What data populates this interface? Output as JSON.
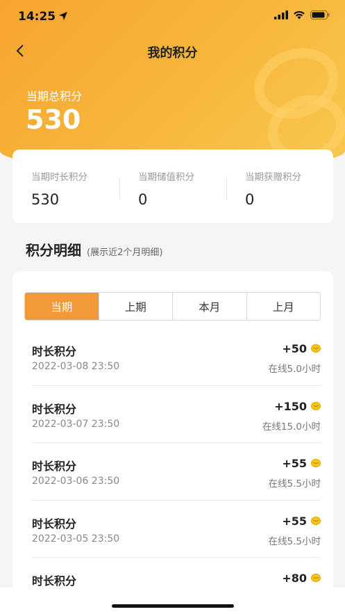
{
  "status_bar": {
    "time": "14:25",
    "icons": [
      "location-arrow-icon",
      "signal-icon",
      "wifi-icon",
      "battery-icon"
    ]
  },
  "nav": {
    "back_icon": "chevron-left-icon",
    "title": "我的积分"
  },
  "total": {
    "label": "当期总积分",
    "value": "530"
  },
  "summary": [
    {
      "label": "当期时长积分",
      "value": "530"
    },
    {
      "label": "当期储值积分",
      "value": "0"
    },
    {
      "label": "当期获赠积分",
      "value": "0"
    }
  ],
  "section": {
    "title": "积分明细",
    "subtitle": "(展示近2个月明细)"
  },
  "tabs": [
    {
      "label": "当期",
      "active": true
    },
    {
      "label": "上期",
      "active": false
    },
    {
      "label": "本月",
      "active": false
    },
    {
      "label": "上月",
      "active": false
    }
  ],
  "records": [
    {
      "title": "时长积分",
      "date": "2022-03-08 23:50",
      "points": "+50",
      "note": "在线5.0小时"
    },
    {
      "title": "时长积分",
      "date": "2022-03-07 23:50",
      "points": "+150",
      "note": "在线15.0小时"
    },
    {
      "title": "时长积分",
      "date": "2022-03-06 23:50",
      "points": "+55",
      "note": "在线5.5小时"
    },
    {
      "title": "时长积分",
      "date": "2022-03-05 23:50",
      "points": "+55",
      "note": "在线5.5小时"
    },
    {
      "title": "时长积分",
      "date": "",
      "points": "+80",
      "note": ""
    }
  ],
  "colors": {
    "accent": "#f29a37",
    "hero_start": "#f6a530",
    "hero_end": "#f9c84f",
    "coin": "#f5c518"
  }
}
